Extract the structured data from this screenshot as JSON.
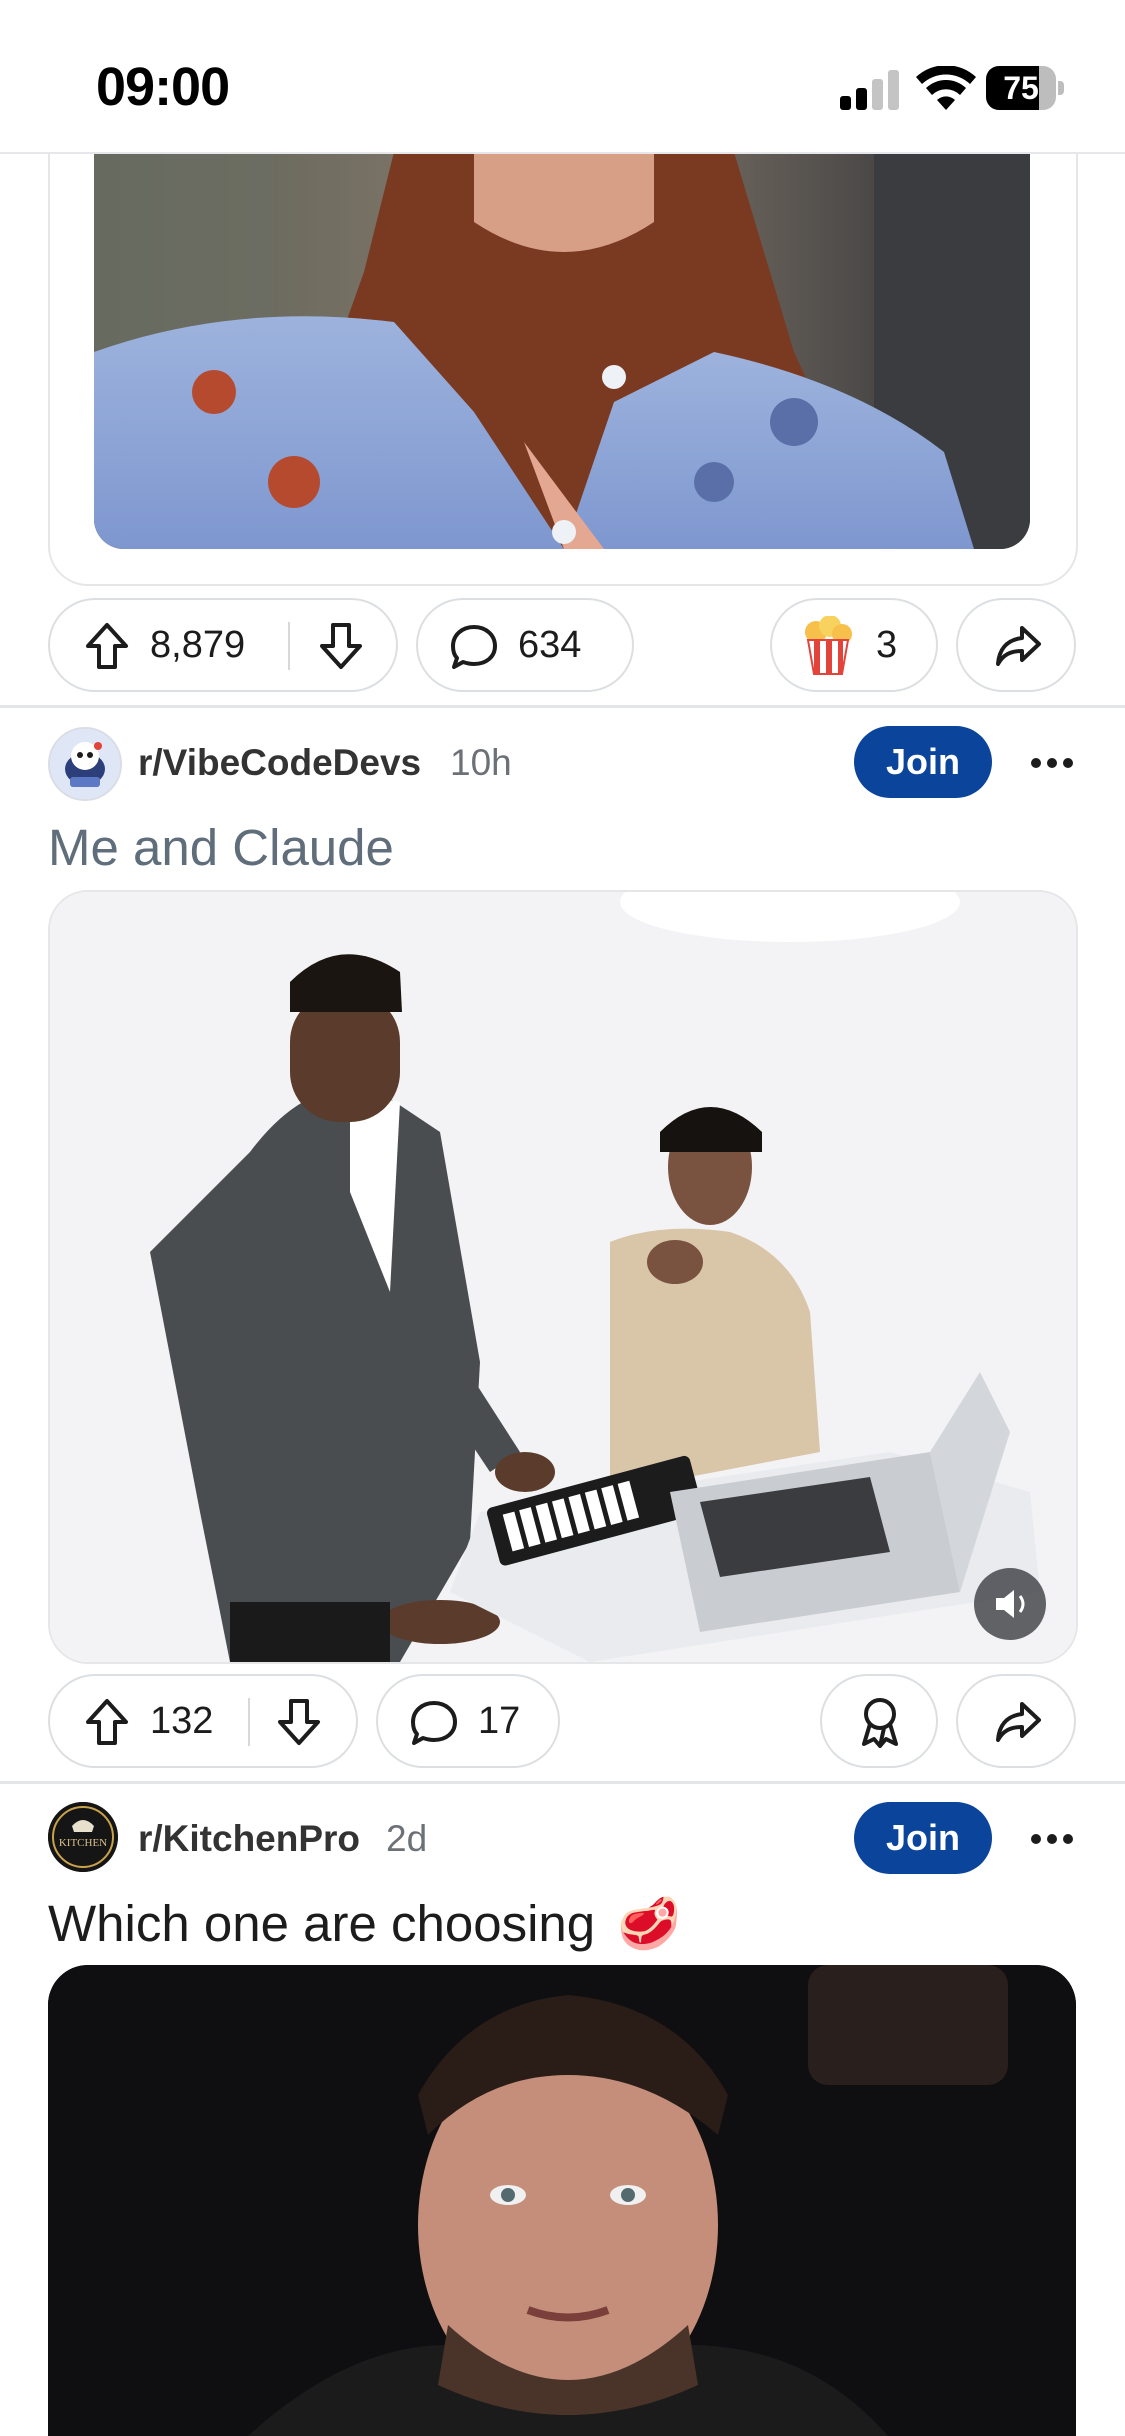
{
  "status_bar": {
    "time": "09:00",
    "battery_level": "75",
    "signal_bars_active": 2,
    "signal_bars_total": 4
  },
  "post1": {
    "upvotes": "8,879",
    "comments": "634",
    "award_count": "3",
    "award_icon": "popcorn-award-icon"
  },
  "post2": {
    "subreddit": "r/VibeCodeDevs",
    "time": "10h",
    "join_label": "Join",
    "title": "Me and Claude",
    "upvotes": "132",
    "comments": "17",
    "award_icon": "award-ribbon-icon"
  },
  "post3": {
    "subreddit": "r/KitchenPro",
    "time": "2d",
    "join_label": "Join",
    "title": "Which one are choosing",
    "title_emoji": "🥩",
    "avatar_text": "KITCHEN"
  },
  "colors": {
    "join": "#0a449b",
    "title_muted": "#5f6e7a",
    "divider": "#e3e5e7"
  }
}
